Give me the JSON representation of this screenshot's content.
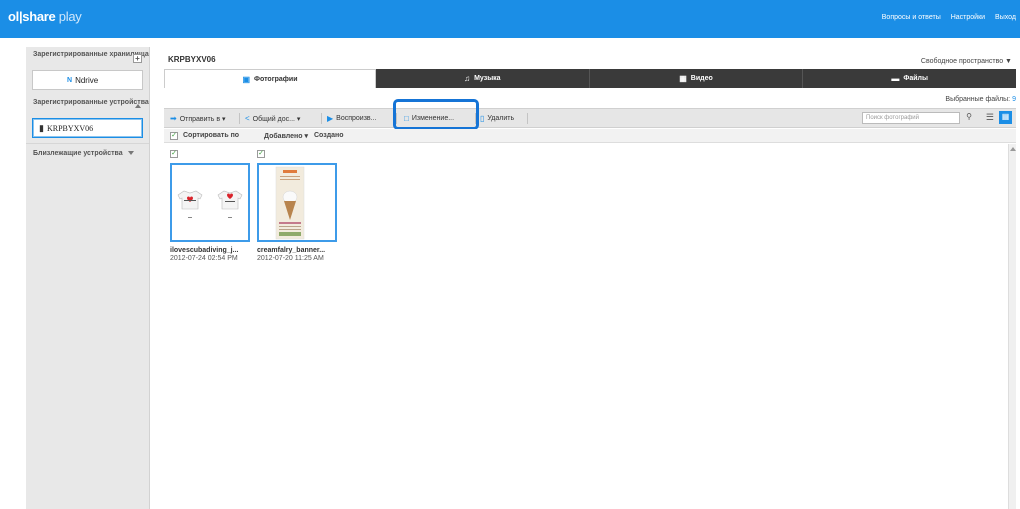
{
  "header": {
    "logo_main": "ol|share",
    "logo_sub": " play",
    "links": [
      "Вопросы и ответы",
      "Настройки",
      "Выход"
    ]
  },
  "sidebar": {
    "registered_storage_label": "Зарегистрированные хранилища",
    "storage_items": [
      {
        "label": "Ndrive",
        "icon": "ndrive-icon"
      }
    ],
    "registered_devices_label": "Зарегистрированные устройства",
    "device_items": [
      {
        "label": "KRPBYXV06",
        "icon": "phone-icon"
      }
    ],
    "nearby_devices_label": "Близлежащие устройства"
  },
  "main": {
    "device_title": "KRPBYXV06",
    "free_space_label": "Свободное пространство ▼",
    "tabs": [
      {
        "label": "Фотографии",
        "icon": "photo-icon",
        "active": true
      },
      {
        "label": "Музыка",
        "icon": "music-note-icon",
        "active": false
      },
      {
        "label": "Видео",
        "icon": "film-icon",
        "active": false
      },
      {
        "label": "Файлы",
        "icon": "folder-icon",
        "active": false
      }
    ],
    "selected_files_label": "Выбранные файлы:",
    "selected_files_count": "9"
  },
  "toolbar": {
    "send": "Отправить в ▾",
    "share": "Общий дос... ▾",
    "play": "Воспроизв...",
    "edit": "Изменение...",
    "delete": "Удалить",
    "search_placeholder": "Поиск фотографий"
  },
  "sortbar": {
    "sort_by": "Сортировать по",
    "added": "Добавлено ▾",
    "created": "Создано"
  },
  "files": [
    {
      "name": "ilovescubadiving_j...",
      "date": "2012-07-24 02:54 PM",
      "checked": true
    },
    {
      "name": "creamfalry_banner...",
      "date": "2012-07-20 11:25 AM",
      "checked": true
    }
  ],
  "colors": {
    "brand": "#1b8ee6",
    "highlight": "#1574d6",
    "tabbar": "#3a3a3a"
  }
}
